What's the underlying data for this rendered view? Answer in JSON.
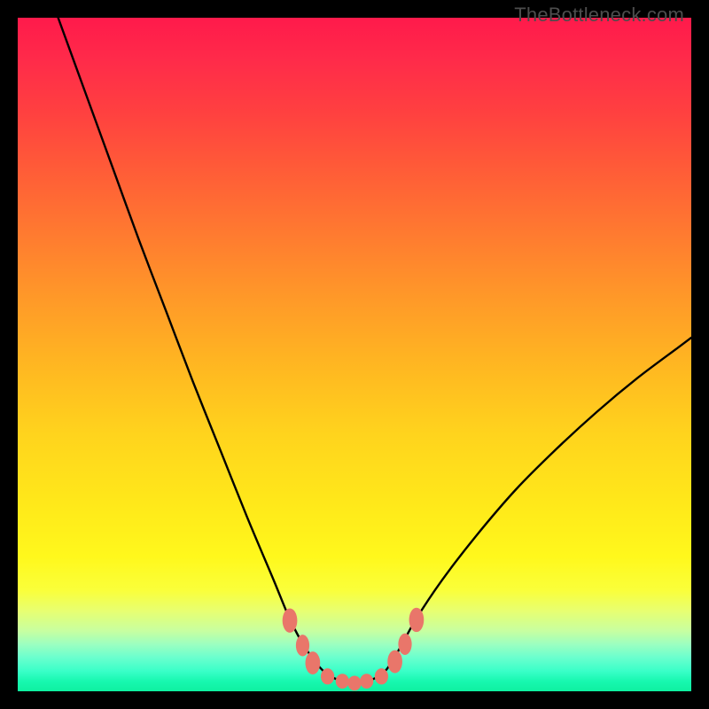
{
  "credit": "TheBottleneck.com",
  "chart_data": {
    "type": "line",
    "title": "",
    "xlabel": "",
    "ylabel": "",
    "xlim": [
      0,
      100
    ],
    "ylim": [
      0,
      100
    ],
    "series": [
      {
        "name": "curve",
        "x": [
          6,
          10,
          14,
          18,
          22,
          26,
          30,
          34,
          38,
          40.5,
          43,
          46,
          50,
          54,
          56.5,
          59,
          63,
          68,
          74,
          80,
          86,
          92,
          98,
          100
        ],
        "values": [
          100,
          89,
          78,
          67,
          56.5,
          46,
          36,
          26,
          16.5,
          10.5,
          6,
          2.5,
          1.2,
          2.5,
          6,
          10.5,
          16.5,
          23,
          30,
          36,
          41.5,
          46.5,
          51,
          52.5
        ]
      }
    ],
    "markers": [
      {
        "name": "left-upper",
        "x": 40.4,
        "y": 10.5,
        "rx": 1.1,
        "ry": 1.8
      },
      {
        "name": "left-mid",
        "x": 42.3,
        "y": 6.8,
        "rx": 1.0,
        "ry": 1.6
      },
      {
        "name": "left-lower",
        "x": 43.8,
        "y": 4.2,
        "rx": 1.1,
        "ry": 1.7
      },
      {
        "name": "bottom-1",
        "x": 46.0,
        "y": 2.2,
        "rx": 1.0,
        "ry": 1.2
      },
      {
        "name": "bottom-2",
        "x": 48.2,
        "y": 1.5,
        "rx": 1.0,
        "ry": 1.1
      },
      {
        "name": "bottom-3",
        "x": 50.0,
        "y": 1.2,
        "rx": 1.0,
        "ry": 1.1
      },
      {
        "name": "bottom-4",
        "x": 51.8,
        "y": 1.5,
        "rx": 1.0,
        "ry": 1.1
      },
      {
        "name": "bottom-5",
        "x": 54.0,
        "y": 2.2,
        "rx": 1.0,
        "ry": 1.2
      },
      {
        "name": "right-lower",
        "x": 56.0,
        "y": 4.4,
        "rx": 1.1,
        "ry": 1.7
      },
      {
        "name": "right-mid",
        "x": 57.5,
        "y": 7.0,
        "rx": 1.0,
        "ry": 1.6
      },
      {
        "name": "right-upper",
        "x": 59.2,
        "y": 10.6,
        "rx": 1.1,
        "ry": 1.8
      }
    ],
    "colors": {
      "curve_stroke": "#000000",
      "marker_fill": "#e9766a",
      "gradient_top": "#ff1a4b",
      "gradient_bottom": "#0ef0a0"
    }
  }
}
